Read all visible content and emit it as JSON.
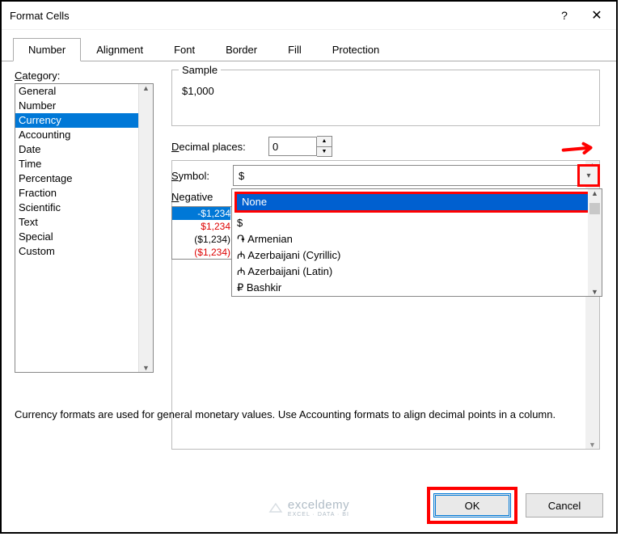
{
  "title": "Format Cells",
  "tabs": [
    "Number",
    "Alignment",
    "Font",
    "Border",
    "Fill",
    "Protection"
  ],
  "active_tab": 0,
  "category_label": "Category:",
  "categories": [
    "General",
    "Number",
    "Currency",
    "Accounting",
    "Date",
    "Time",
    "Percentage",
    "Fraction",
    "Scientific",
    "Text",
    "Special",
    "Custom"
  ],
  "selected_category_index": 2,
  "sample_label": "Sample",
  "sample_value": "$1,000",
  "decimal_label": "Decimal places:",
  "decimal_value": "0",
  "symbol_label": "Symbol:",
  "symbol_value": "$",
  "negative_label": "Negative",
  "negative_numbers": [
    {
      "text": "-$1,234",
      "style": "sel"
    },
    {
      "text": "$1,234",
      "style": "red"
    },
    {
      "text": "($1,234)",
      "style": "black"
    },
    {
      "text": "($1,234)",
      "style": "red"
    }
  ],
  "symbol_options": [
    "None",
    "$",
    "֏ Armenian",
    "₼ Azerbaijani (Cyrillic)",
    "₼ Azerbaijani (Latin)",
    "₽ Bashkir"
  ],
  "symbol_selected_option": 0,
  "description": "Currency formats are used for general monetary values.  Use Accounting formats to align decimal points in a column.",
  "ok_label": "OK",
  "cancel_label": "Cancel",
  "watermark_brand": "exceldemy",
  "watermark_tag": "EXCEL · DATA · BI"
}
